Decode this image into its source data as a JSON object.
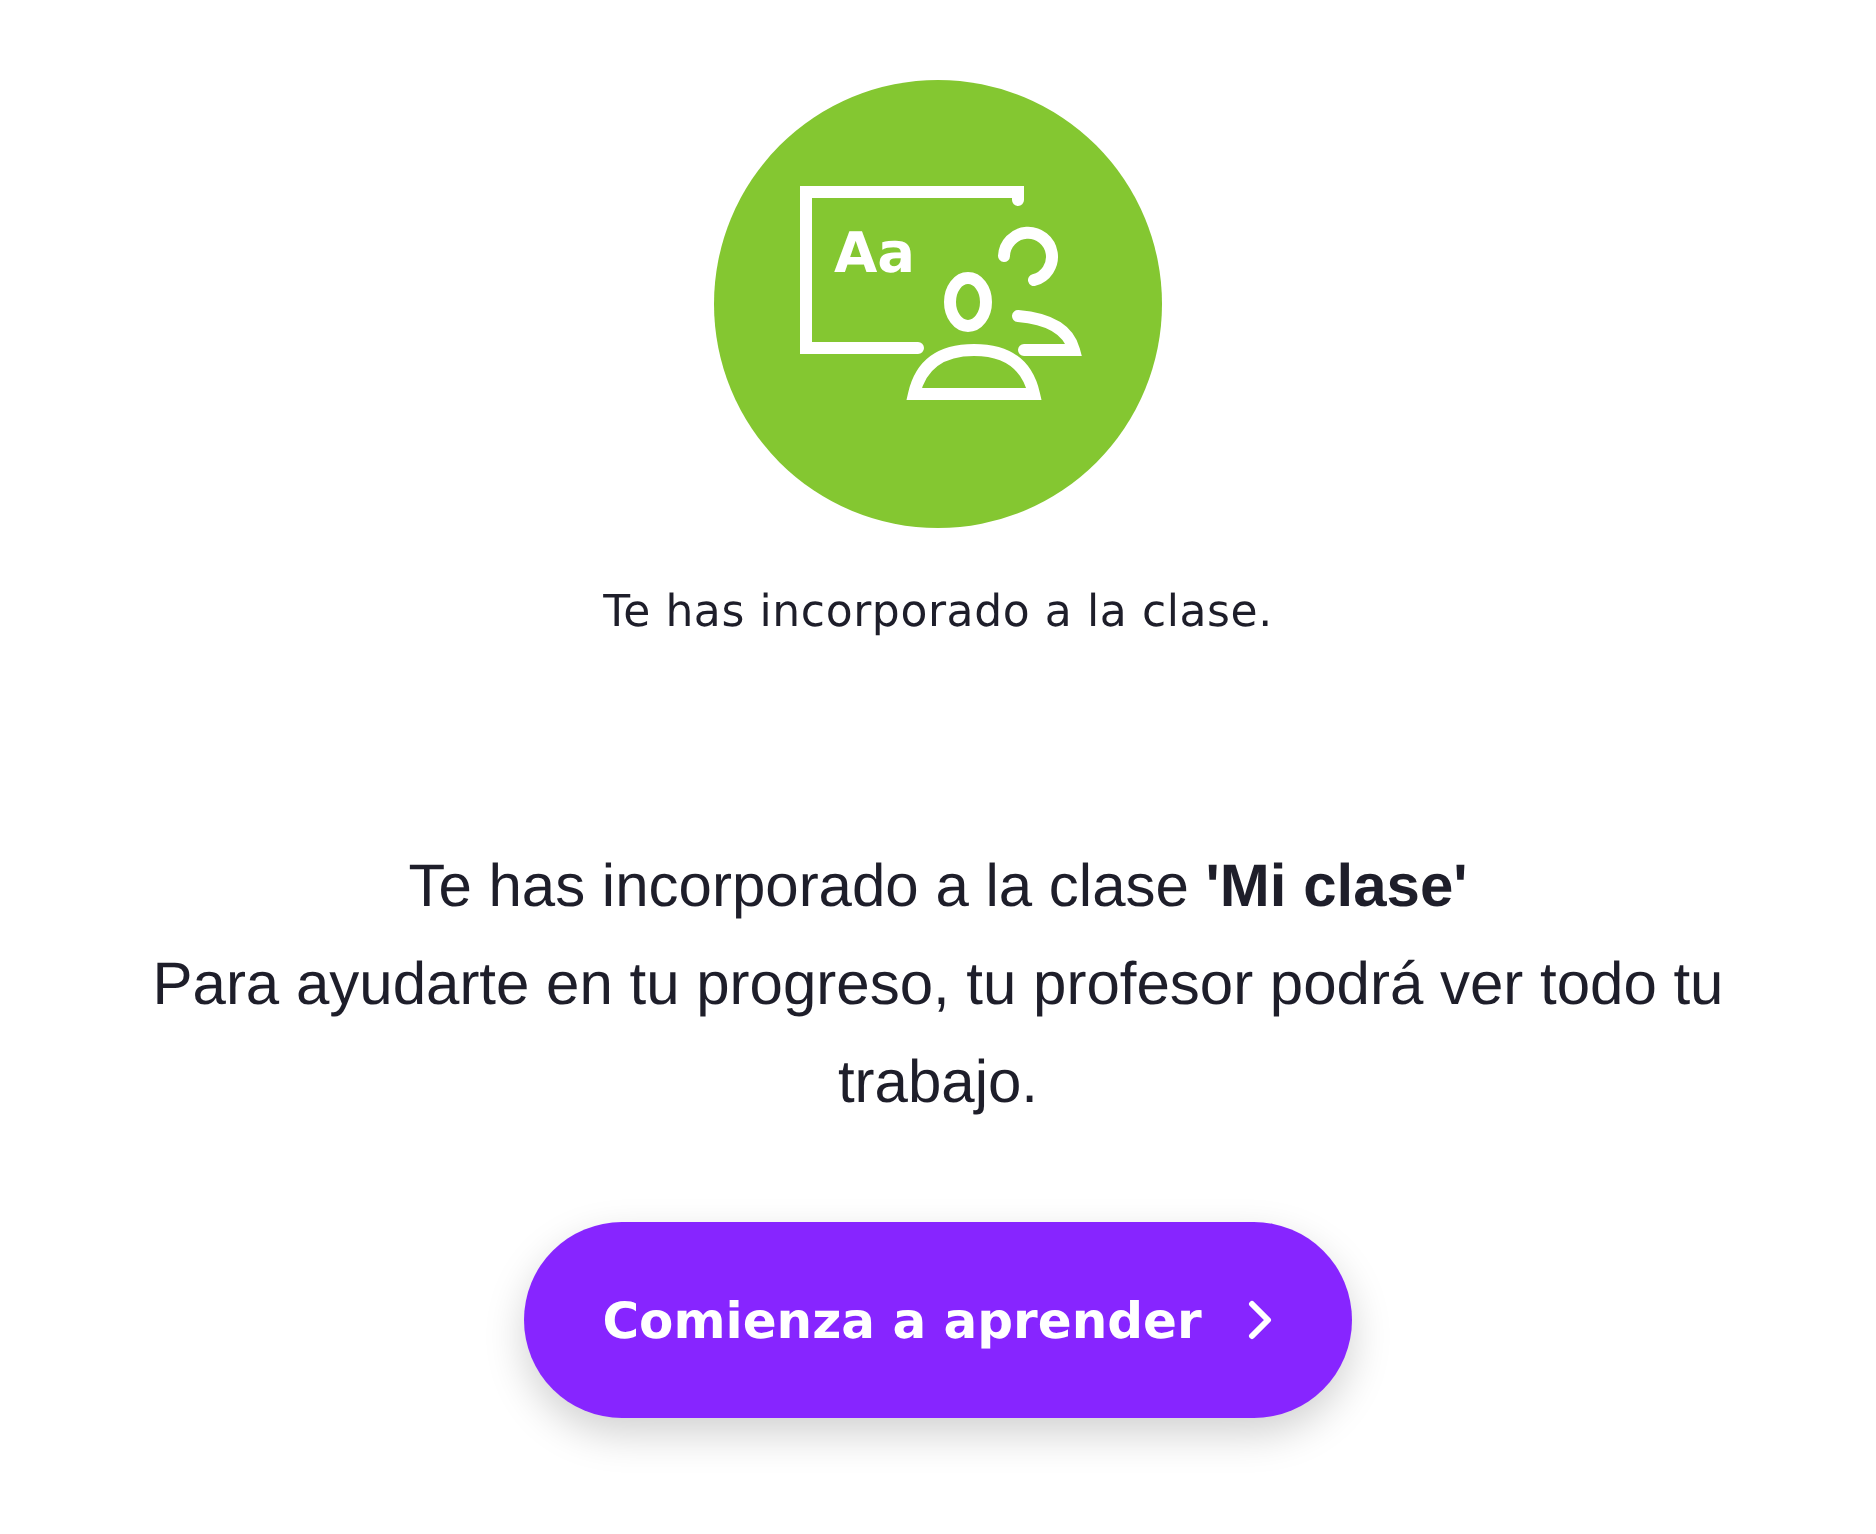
{
  "badge": {
    "icon_text": "Aa"
  },
  "caption": "Te has incorporado a la clase.",
  "message": {
    "lines": [
      "Te has incorporado a la clase **'Mi clase'**",
      "Para ayudarte en tu progreso, tu profesor podrá ver todo tu trabajo."
    ]
  },
  "button": {
    "label": "Comienza a aprender"
  }
}
